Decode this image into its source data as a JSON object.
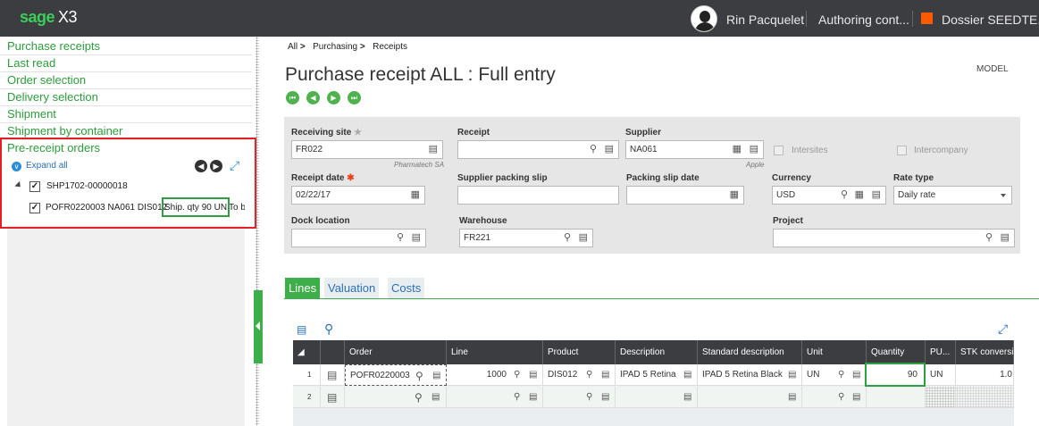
{
  "topbar": {
    "logo_sage": "sage",
    "logo_x3": "X3",
    "user_name": "Rin Pacquelet",
    "authoring": "Authoring cont...",
    "dossier": "Dossier SEEDTE...",
    "dossier_color": "#ff5a00"
  },
  "sidebar": {
    "links": [
      "Purchase receipts",
      "Last read",
      "Order selection",
      "Delivery selection",
      "Shipment",
      "Shipment by container",
      "Pre-receipt orders"
    ],
    "expand_all": "Expand all",
    "tree": {
      "shipment": "SHP1702-00000018",
      "order_line_prefix": "POFR0220003 NA061 DIS012",
      "order_line_highlight": "Ship. qty 90 UN",
      "order_line_suffix": "To b"
    }
  },
  "breadcrumb": {
    "items": [
      "All",
      "Purchasing",
      "Receipts"
    ]
  },
  "page": {
    "title": "Purchase receipt ALL : Full entry",
    "model": "MODEL"
  },
  "form": {
    "receiving_site": {
      "label": "Receiving site",
      "value": "FR022",
      "sub": "Pharmatech SA"
    },
    "receipt": {
      "label": "Receipt",
      "value": ""
    },
    "supplier": {
      "label": "Supplier",
      "value": "NA061",
      "sub": "Apple"
    },
    "intersites": {
      "label": "Intersites"
    },
    "intercompany": {
      "label": "Intercompany"
    },
    "receipt_date": {
      "label": "Receipt date",
      "value": "02/22/17"
    },
    "supplier_packing_slip": {
      "label": "Supplier packing slip",
      "value": ""
    },
    "packing_slip_date": {
      "label": "Packing slip date",
      "value": ""
    },
    "currency": {
      "label": "Currency",
      "value": "USD"
    },
    "rate_type": {
      "label": "Rate type",
      "value": "Daily rate"
    },
    "dock_location": {
      "label": "Dock location",
      "value": ""
    },
    "warehouse": {
      "label": "Warehouse",
      "value": "FR221"
    },
    "project": {
      "label": "Project",
      "value": ""
    }
  },
  "tabs": [
    "Lines",
    "Valuation",
    "Costs"
  ],
  "grid": {
    "headers": [
      "Order",
      "Line",
      "Product",
      "Description",
      "Standard description",
      "Unit",
      "Quantity",
      "PU...",
      "STK conversio"
    ],
    "rows": [
      {
        "num": "1",
        "order": "POFR0220003",
        "line": "1000",
        "product": "DIS012",
        "description": "IPAD 5 Retina",
        "std_description": "IPAD 5 Retina Black",
        "unit": "UN",
        "quantity": "90",
        "pu": "UN",
        "stk": "1.0"
      },
      {
        "num": "2",
        "order": "",
        "line": "",
        "product": "",
        "description": "",
        "std_description": "",
        "unit": "",
        "quantity": "",
        "pu": "",
        "stk": ""
      }
    ]
  },
  "colors": {
    "accent_green": "#3dae49",
    "highlight_red": "#e11f26",
    "link_green": "#2d9c3c",
    "topbar": "#3b3d40"
  }
}
